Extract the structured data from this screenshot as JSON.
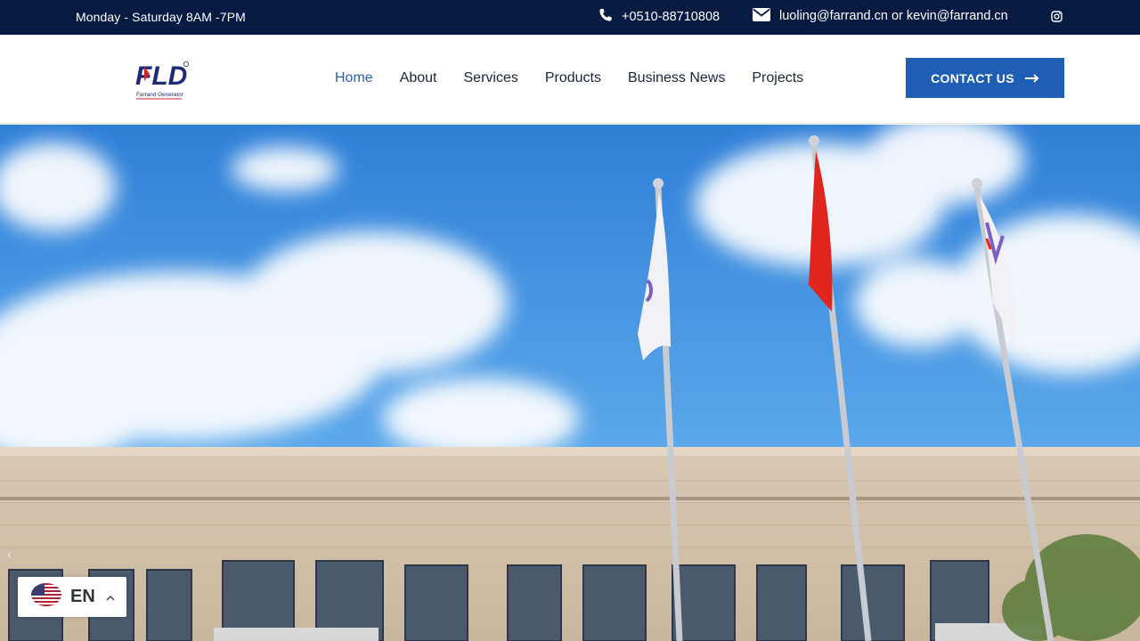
{
  "topbar": {
    "hours": "Monday - Saturday 8AM -7PM",
    "phone": "+0510-88710808",
    "email": "luoling@farrand.cn or kevin@farrand.cn",
    "icons": [
      "phone-icon",
      "envelope-icon",
      "instagram-icon"
    ]
  },
  "header": {
    "logo_text": "FLD",
    "logo_subtext": "Farrand Generator",
    "nav": [
      {
        "label": "Home",
        "active": true
      },
      {
        "label": "About"
      },
      {
        "label": "Services"
      },
      {
        "label": "Products"
      },
      {
        "label": "Business News"
      },
      {
        "label": "Projects"
      }
    ],
    "cta_label": "CONTACT US"
  },
  "hero": {
    "prev_arrow": "‹"
  },
  "language": {
    "code": "EN",
    "flag": "us-flag-icon"
  },
  "colors": {
    "topbar_bg": "#061a42",
    "accent": "#1f5eb5",
    "nav_active": "#2a5fb0"
  }
}
